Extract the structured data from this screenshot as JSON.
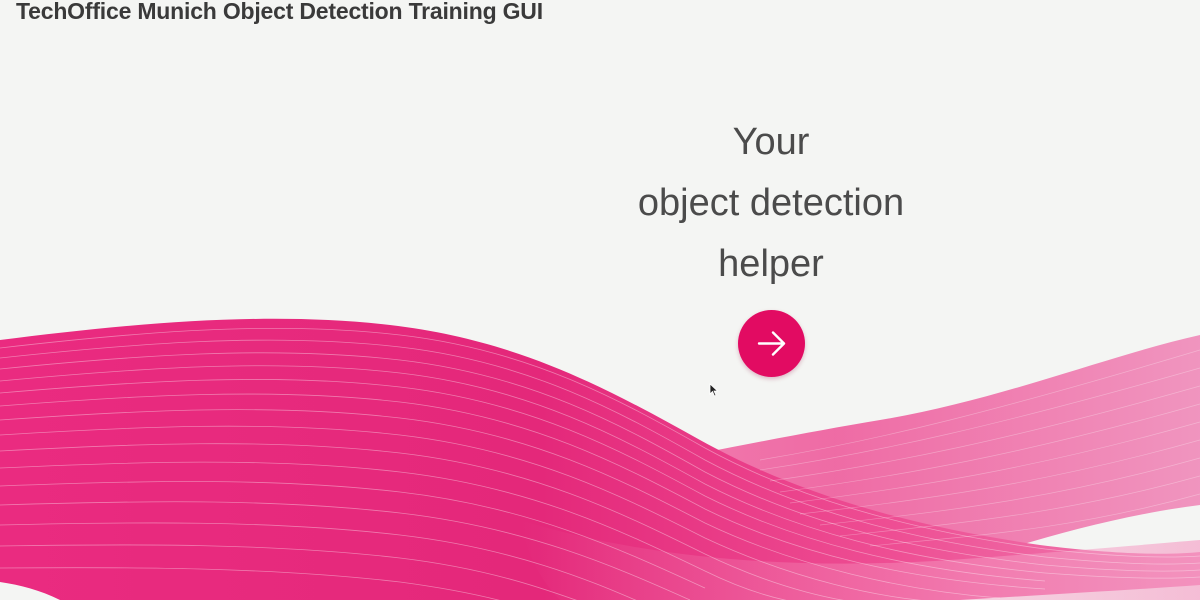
{
  "app": {
    "title": "TechOffice Munich Object Detection Training GUI"
  },
  "hero": {
    "line1": "Your",
    "line2": "object detection",
    "line3": "helper"
  },
  "start_button": {
    "icon": "arrow-right-icon"
  },
  "colors": {
    "background": "#f4f5f3",
    "accent": "#e20b62",
    "wave_pink": "#ec3e8c",
    "wave_light": "#f084b5",
    "text": "#4b4b4b"
  }
}
